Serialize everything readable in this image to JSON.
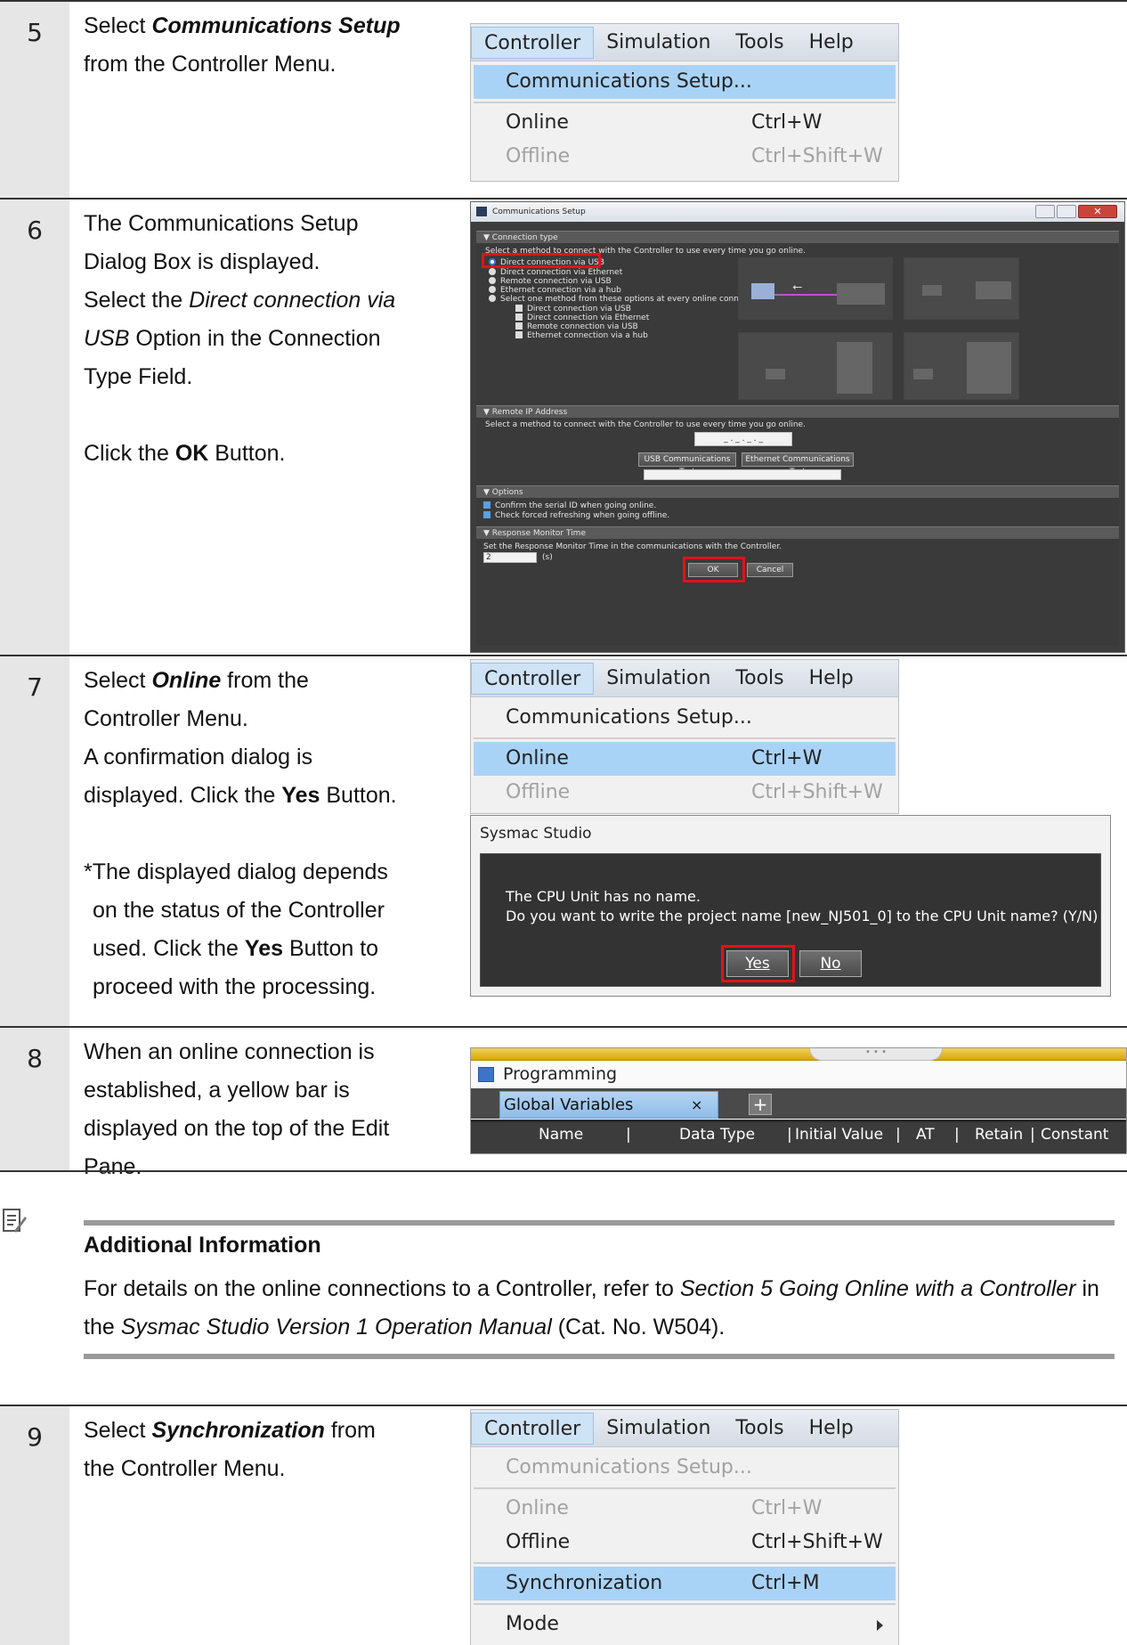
{
  "steps": [
    {
      "num": "5",
      "lines": [
        {
          "pre": "Select ",
          "bi": "Communications Setup",
          "post": ""
        },
        {
          "pre": "from the Controller Menu.",
          "bi": "",
          "post": ""
        }
      ]
    },
    {
      "num": "6",
      "lines": [
        "The Communications Setup",
        "Dialog Box is displayed.",
        "Select the ",
        "Direct connection via",
        "USB",
        " Option in the Connection",
        "Type Field.",
        "Click the ",
        "OK",
        " Button."
      ]
    },
    {
      "num": "7",
      "l1_pre": "Select ",
      "l1_bi": "Online",
      "l1_post": " from the",
      "l2": "Controller Menu.",
      "l3": "A confirmation dialog is",
      "l4_pre": "displayed. Click the ",
      "l4_b": "Yes",
      "l4_post": " Button.",
      "n1": "*The displayed dialog depends",
      "n2": "on the status of the Controller",
      "n3_pre": "used. Click the ",
      "n3_b": "Yes",
      "n3_post": " Button to",
      "n4": "proceed with the processing."
    },
    {
      "num": "8",
      "l1": "When an online connection is",
      "l2": "established, a yellow bar is",
      "l3": "displayed on the top of the Edit",
      "l4": "Pane."
    },
    {
      "num": "9",
      "l1_pre": "Select ",
      "l1_bi": "Synchronization",
      "l1_post": " from",
      "l2": "the Controller Menu."
    }
  ],
  "menu": {
    "bar": [
      "Controller",
      "Simulation",
      "Tools",
      "Help"
    ],
    "comm": "Communications Setup...",
    "online": "Online",
    "online_sc": "Ctrl+W",
    "offline": "Offline",
    "offline_sc": "Ctrl+Shift+W",
    "sync": "Synchronization",
    "sync_sc": "Ctrl+M",
    "mode": "Mode"
  },
  "comm_dialog": {
    "title": "Communications Setup",
    "sec_conn": "Connection type",
    "conn_desc": "Select a method to connect with the Controller to use every time you go online.",
    "opts": [
      "Direct connection via USB",
      "Direct connection via Ethernet",
      "Remote connection via USB",
      "Ethernet connection via a hub",
      "Select one method from these options at every online connection."
    ],
    "subopts": [
      "Direct connection via USB",
      "Direct connection via Ethernet",
      "Remote connection via USB",
      "Ethernet connection via a hub"
    ],
    "sec_ip": "Remote IP Address",
    "ip_desc": "Select a method to connect with the Controller to use every time you go online.",
    "ip_val": "_ . _ . _ . _",
    "usb_test": "USB Communications Test",
    "eth_test": "Ethernet Communications Test",
    "sec_opt": "Options",
    "opt1": "Confirm the serial ID when going online.",
    "opt2": "Check forced refreshing when going offline.",
    "sec_resp": "Response Monitor Time",
    "resp_desc": "Set the Response Monitor Time in the communications with the Controller.",
    "resp_val": "2",
    "resp_unit": "(s)",
    "ok": "OK",
    "cancel": "Cancel"
  },
  "sysmac_dialog": {
    "title": "Sysmac Studio",
    "msg1": "The CPU Unit has no name.",
    "msg2": "Do you want to write the project name [new_NJ501_0] to the CPU Unit name? (Y/N)",
    "yes": "Yes",
    "no": "No"
  },
  "programming": {
    "title": "Programming",
    "tab": "Global Variables",
    "tab_close": "×",
    "plus": "+",
    "cols": [
      "Name",
      "Data Type",
      "Initial Value",
      "AT",
      "Retain",
      "Constant"
    ]
  },
  "info": {
    "title": "Additional Information",
    "t1": "For details on the online connections to a Controller, refer to ",
    "i1": "Section 5 Going Online with a Controller",
    "t2": " in the ",
    "i2": "Sysmac Studio Version 1 Operation Manual",
    "t3": " (Cat. No. W504)."
  }
}
